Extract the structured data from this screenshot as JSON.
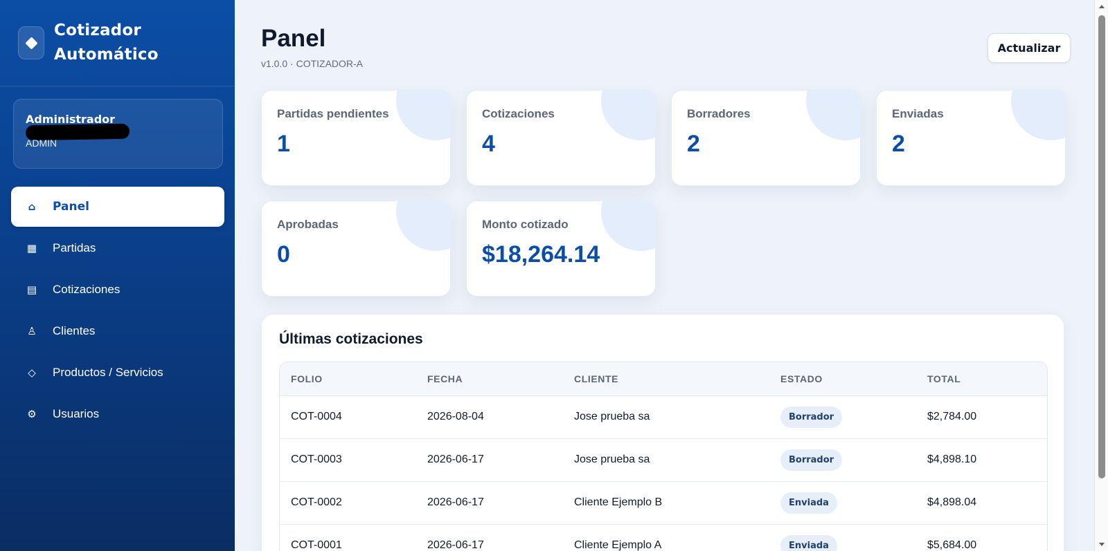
{
  "brand": {
    "title": "Cotizador Automático",
    "icon": "diamond-icon"
  },
  "user": {
    "name": "Administrador",
    "role": "ADMIN"
  },
  "nav": [
    {
      "label": "Panel",
      "icon": "home-icon",
      "glyph": "⌂",
      "active": true
    },
    {
      "label": "Partidas",
      "icon": "grid-icon",
      "glyph": "▦",
      "active": false
    },
    {
      "label": "Cotizaciones",
      "icon": "list-icon",
      "glyph": "▤",
      "active": false
    },
    {
      "label": "Clientes",
      "icon": "person-icon",
      "glyph": "♙",
      "active": false
    },
    {
      "label": "Productos / Servicios",
      "icon": "diamond-outline-icon",
      "glyph": "◇",
      "active": false
    },
    {
      "label": "Usuarios",
      "icon": "gear-icon",
      "glyph": "⚙",
      "active": false
    }
  ],
  "header": {
    "title": "Panel",
    "subtitle": "v1.0.0 · COTIZADOR-A",
    "refresh_label": "Actualizar"
  },
  "stats": [
    {
      "label": "Partidas pendientes",
      "value": "1"
    },
    {
      "label": "Cotizaciones",
      "value": "4"
    },
    {
      "label": "Borradores",
      "value": "2"
    },
    {
      "label": "Enviadas",
      "value": "2"
    },
    {
      "label": "Aprobadas",
      "value": "0"
    },
    {
      "label": "Monto cotizado",
      "value": "$18,264.14"
    }
  ],
  "recent": {
    "title": "Últimas cotizaciones",
    "columns": [
      "FOLIO",
      "FECHA",
      "CLIENTE",
      "ESTADO",
      "TOTAL"
    ],
    "rows": [
      {
        "folio": "COT-0004",
        "fecha": "2026-08-04",
        "cliente": "Jose prueba sa",
        "estado": "Borrador",
        "total": "$2,784.00"
      },
      {
        "folio": "COT-0003",
        "fecha": "2026-06-17",
        "cliente": "Jose prueba sa",
        "estado": "Borrador",
        "total": "$4,898.10"
      },
      {
        "folio": "COT-0002",
        "fecha": "2026-06-17",
        "cliente": "Cliente Ejemplo B",
        "estado": "Enviada",
        "total": "$4,898.04"
      },
      {
        "folio": "COT-0001",
        "fecha": "2026-06-17",
        "cliente": "Cliente Ejemplo A",
        "estado": "Enviada",
        "total": "$5,684.00"
      }
    ]
  },
  "colors": {
    "accent": "#0b4ea6",
    "sidebar_top": "#0b4ea6",
    "sidebar_bottom": "#0a2d63"
  }
}
